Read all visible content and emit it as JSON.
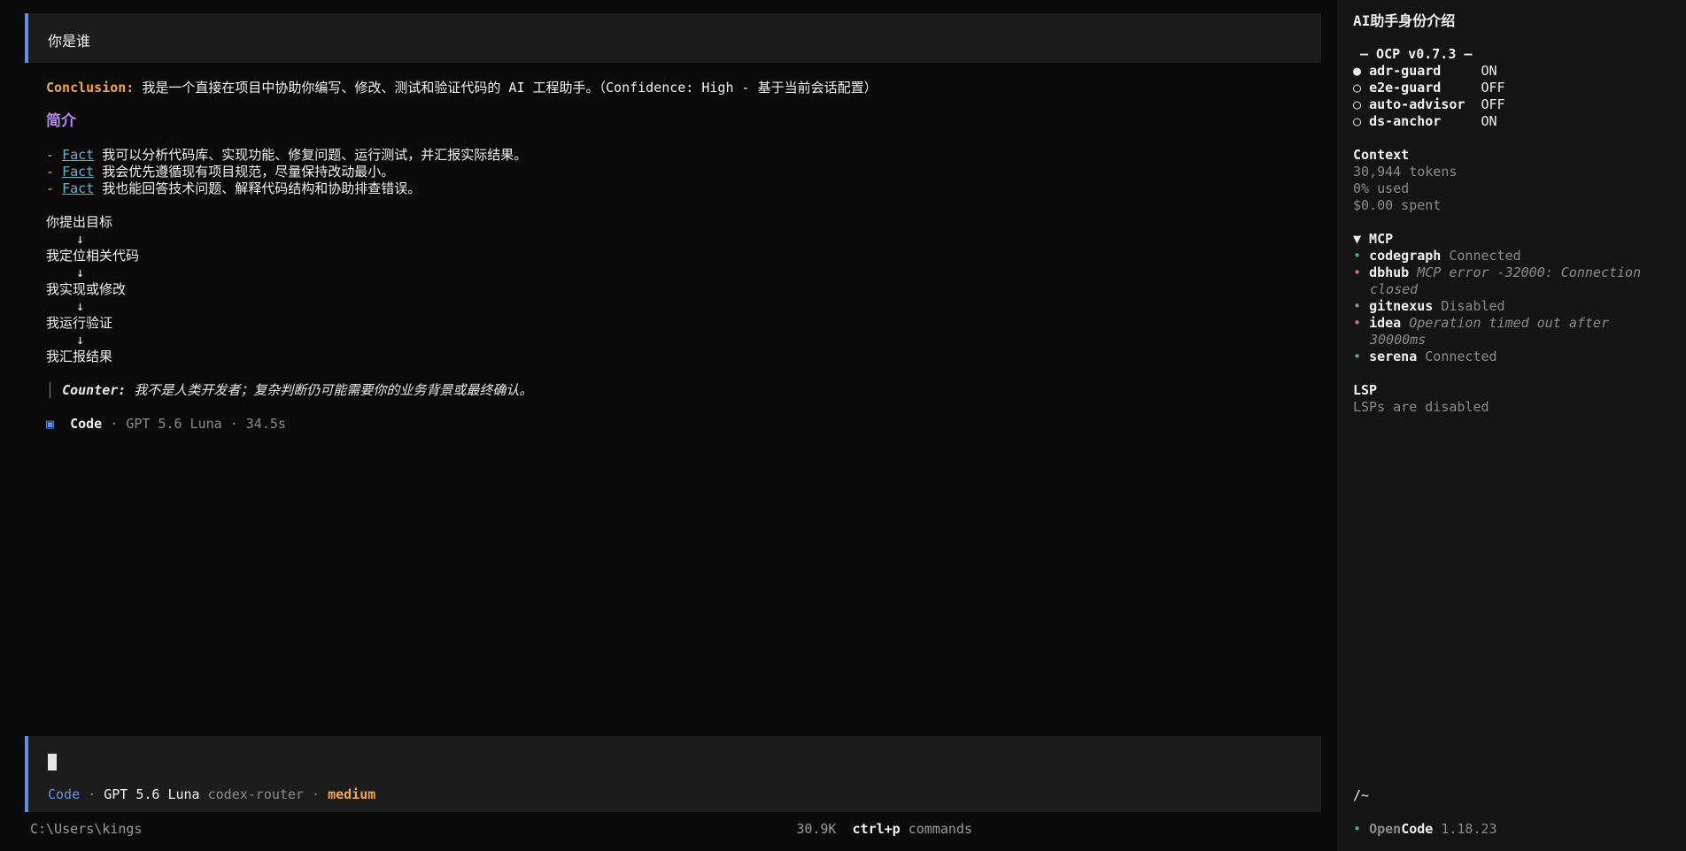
{
  "user_message": "你是谁",
  "response": {
    "conclusion_label": "Conclusion:",
    "conclusion_text": " 我是一个直接在项目中协助你编写、修改、测试和验证代码的 AI 工程助手。（Confidence: High - 基于当前会话配置）",
    "section_title": "简介",
    "facts": [
      {
        "dash": "-",
        "tag": "Fact",
        "text": " 我可以分析代码库、实现功能、修复问题、运行测试，并汇报实际结果。"
      },
      {
        "dash": "-",
        "tag": "Fact",
        "text": " 我会优先遵循现有项目规范，尽量保持改动最小。"
      },
      {
        "dash": "-",
        "tag": "Fact",
        "text": " 我也能回答技术问题、解释代码结构和协助排查错误。"
      }
    ],
    "flow": {
      "steps": [
        "你提出目标",
        "我定位相关代码",
        "我实现或修改",
        "我运行验证",
        "我汇报结果"
      ],
      "arrow": "↓"
    },
    "counter_bar": "│",
    "counter_label": "Counter:",
    "counter_text": " 我不是人类开发者；复杂判断仍可能需要你的业务背景或最终确认。",
    "meta": {
      "icon": "▣",
      "mode": "Code",
      "sep": "·",
      "model": "GPT 5.6 Luna",
      "time": "34.5s"
    }
  },
  "input": {
    "mode": "Code",
    "sep": "·",
    "model": "GPT 5.6 Luna",
    "provider": "codex-router",
    "effort": "medium"
  },
  "footer": {
    "path": "C:\\Users\\kings",
    "tokens": "30.9K",
    "shortcut": "ctrl+p",
    "shortcut_label": "commands"
  },
  "sidebar": {
    "title": "AI助手身份介绍",
    "ocp_header": "– OCP v0.7.3 –",
    "ocp_items": [
      {
        "bullet": "●",
        "name": "adr-guard   ",
        "state": "ON"
      },
      {
        "bullet": "○",
        "name": "e2e-guard   ",
        "state": "OFF"
      },
      {
        "bullet": "○",
        "name": "auto-advisor",
        "state": "OFF"
      },
      {
        "bullet": "○",
        "name": "ds-anchor   ",
        "state": "ON"
      }
    ],
    "context": {
      "title": "Context",
      "tokens": "30,944 tokens",
      "used": "0% used",
      "spent": "$0.00 spent"
    },
    "mcp": {
      "title": "▼ MCP",
      "servers": [
        {
          "name": "codegraph",
          "status": "Connected",
          "color": "#4caf7a"
        },
        {
          "name": "dbhub",
          "status": "MCP error -32000: Connection",
          "status2": "closed",
          "color": "#e36a6a"
        },
        {
          "name": "gitnexus",
          "status": "Disabled",
          "color": "#8a8a8a"
        },
        {
          "name": "idea",
          "status": "Operation timed out after",
          "status2": "30000ms",
          "color": "#e36a6a"
        },
        {
          "name": "serena",
          "status": "Connected",
          "color": "#4caf7a"
        }
      ]
    },
    "lsp": {
      "title": "LSP",
      "text": "LSPs are disabled"
    },
    "cwd": "/~",
    "app": {
      "dot": "•",
      "open": "Open",
      "code": "Code",
      "version": "1.18.23"
    }
  }
}
